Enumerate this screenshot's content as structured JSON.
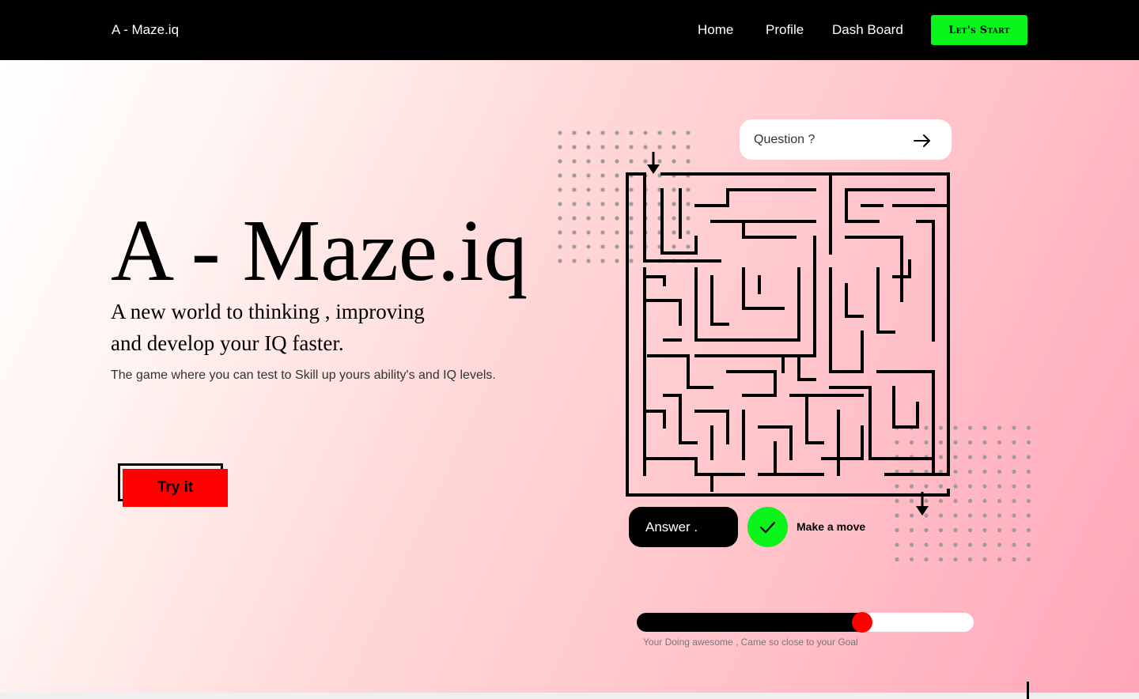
{
  "nav": {
    "brand": "A - Maze.iq",
    "links": [
      "Home",
      "Profile",
      "Dash Board"
    ],
    "cta_label": "Let's Start",
    "cta_color": "#0bf41b"
  },
  "hero": {
    "title": "A - Maze.iq",
    "subtitle_line1": "A new world to thinking , improving",
    "subtitle_line2": "and develop your IQ faster.",
    "description": "The game where you can test to Skill up yours ability's and IQ levels.",
    "try_label": "Try it",
    "try_color": "#ff0000"
  },
  "game": {
    "question_placeholder": "Question ?",
    "answer_label": "Answer .",
    "make_move_label": "Make a move",
    "check_color": "#0bf41b",
    "progress_percent": 67,
    "progress_message": "Your Doing awesome , Came so close to your Goal"
  }
}
